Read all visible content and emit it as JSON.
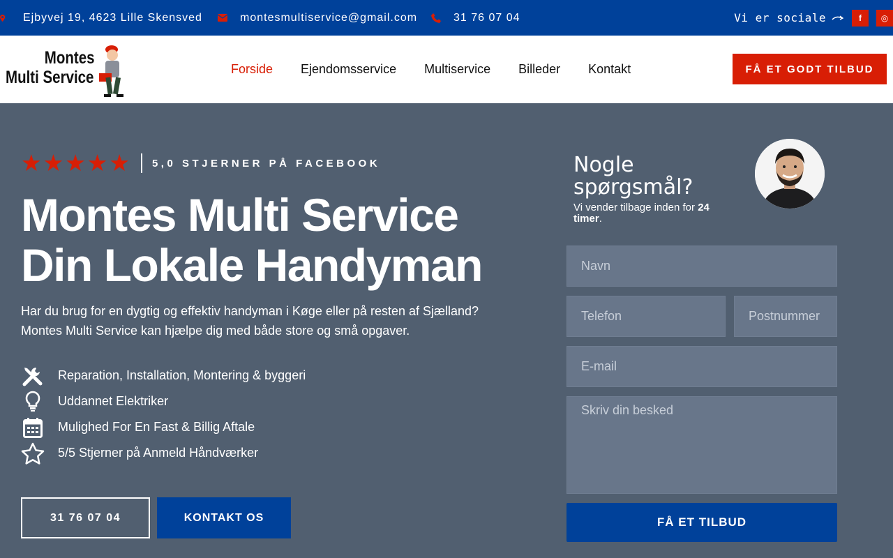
{
  "topbar": {
    "address": "Ejbyvej 19, 4623 Lille Skensved",
    "email": "montesmultiservice@gmail.com",
    "phone": "31 76 07 04",
    "social_label": "Vi er sociale",
    "social": [
      {
        "icon": "facebook-icon",
        "glyph": "f"
      },
      {
        "icon": "instagram-icon",
        "glyph": "◎"
      }
    ]
  },
  "header": {
    "logo_line1": "Montes",
    "logo_line2": "Multi Service",
    "nav": [
      "Forside",
      "Ejendomsservice",
      "Multiservice",
      "Billeder",
      "Kontakt"
    ],
    "active_nav": "Forside",
    "cta": "FÅ ET GODT TILBUD"
  },
  "hero": {
    "rating_text": "5,0 STJERNER PÅ FACEBOOK",
    "rating": 5,
    "title_line1": "Montes Multi Service",
    "title_line2": "Din Lokale Handyman",
    "desc_line1": "Har du brug for en dygtig og effektiv handyman i Køge eller på resten af Sjælland?",
    "desc_line2": "Montes Multi Service kan hjælpe dig med både store og små opgaver.",
    "features": [
      {
        "icon": "tools-icon",
        "text": "Reparation, Installation, Montering & byggeri"
      },
      {
        "icon": "lightbulb-icon",
        "text": "Uddannet Elektriker"
      },
      {
        "icon": "calendar-icon",
        "text": "Mulighed For En Fast & Billig Aftale"
      },
      {
        "icon": "star-outline-icon",
        "text": "5/5 Stjerner på Anmeld Håndværker"
      }
    ],
    "btn_phone": "31 76 07 04",
    "btn_contact": "KONTAKT OS"
  },
  "form": {
    "title_line1": "Nogle",
    "title_line2": "spørgsmål?",
    "subtitle_pre": "Vi vender tilbage inden for ",
    "subtitle_bold": "24 timer",
    "subtitle_post": ".",
    "placeholders": {
      "name": "Navn",
      "phone": "Telefon",
      "zip": "Postnummer",
      "email": "E-mail",
      "message": "Skriv din besked"
    },
    "submit": "FÅ ET TILBUD"
  },
  "colors": {
    "topbar": "#00419a",
    "accent_red": "#d81e05",
    "hero_bg": "#515f70",
    "field_bg": "#68768a"
  }
}
